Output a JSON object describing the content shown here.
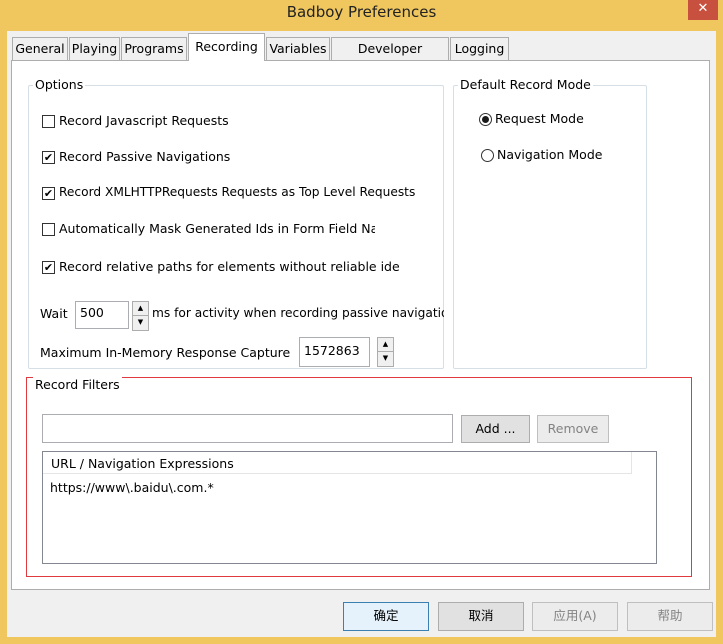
{
  "window": {
    "title": "Badboy Preferences",
    "close_glyph": "✕",
    "colors": {
      "titlebar": "#f0c75e",
      "close": "#c7503e",
      "highlight": "#e0393e"
    }
  },
  "tabs": [
    {
      "label": "General",
      "selected": false
    },
    {
      "label": "Playing",
      "selected": false
    },
    {
      "label": "Programs",
      "selected": false
    },
    {
      "label": "Recording",
      "selected": true
    },
    {
      "label": "Variables",
      "selected": false
    },
    {
      "label": "Developer Settings",
      "selected": false
    },
    {
      "label": "Logging",
      "selected": false
    }
  ],
  "options": {
    "title": "Options",
    "checkboxes": [
      {
        "label": "Record Javascript Requests",
        "checked": false
      },
      {
        "label": "Record Passive Navigations",
        "checked": true
      },
      {
        "label": "Record XMLHTTPRequests Requests as Top Level Requests",
        "checked": true
      },
      {
        "label": "Automatically Mask Generated Ids in Form Field Name",
        "checked": false
      },
      {
        "label": "Record relative paths for elements without reliable identifi",
        "checked": true
      }
    ],
    "wait_label": "Wait",
    "wait_value": "500",
    "wait_suffix": "ms for activity when recording passive navigations",
    "capture_label": "Maximum In-Memory Response Capture",
    "capture_value": "1572863"
  },
  "record_mode": {
    "title": "Default Record Mode",
    "options": [
      {
        "label": "Request Mode",
        "selected": true
      },
      {
        "label": "Navigation Mode",
        "selected": false
      }
    ]
  },
  "filters": {
    "title": "Record Filters",
    "input_value": "",
    "add_label": "Add ...",
    "remove_label": "Remove",
    "column_header": "URL / Navigation Expressions",
    "rows": [
      "https://www\\.baidu\\.com.*"
    ]
  },
  "footer": {
    "ok": "确定",
    "cancel": "取消",
    "apply": "应用(A)",
    "help": "帮助"
  }
}
